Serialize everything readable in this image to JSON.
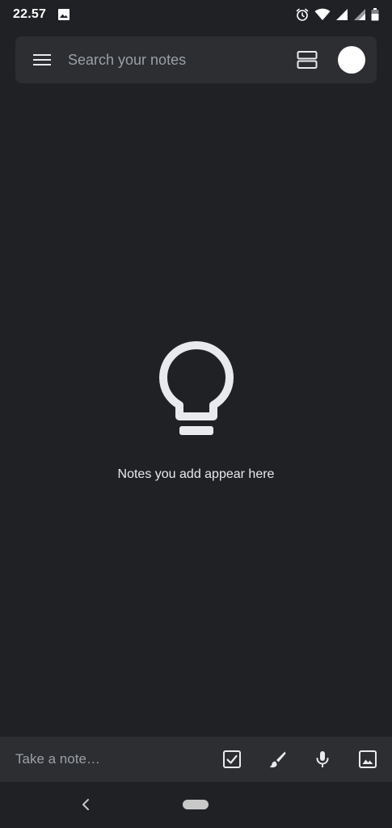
{
  "status_bar": {
    "time": "22.57",
    "icons": [
      "image-icon",
      "alarm-icon",
      "wifi-icon",
      "signal-icon",
      "signal-icon",
      "battery-icon"
    ]
  },
  "search_bar": {
    "placeholder": "Search your notes",
    "menu_icon": "menu-icon",
    "layout_icon": "view-agenda-icon"
  },
  "empty_state": {
    "icon": "lightbulb-icon",
    "message": "Notes you add appear here"
  },
  "bottom_bar": {
    "placeholder": "Take a note…",
    "actions": [
      "checkbox-icon",
      "brush-icon",
      "mic-icon",
      "image-icon"
    ]
  },
  "nav_bar": {
    "icons": [
      "back-icon",
      "home-pill"
    ]
  },
  "colors": {
    "background": "#202124",
    "surface": "#2d2e32",
    "text_primary": "#e8eaed",
    "text_secondary": "#9aa0a6"
  }
}
